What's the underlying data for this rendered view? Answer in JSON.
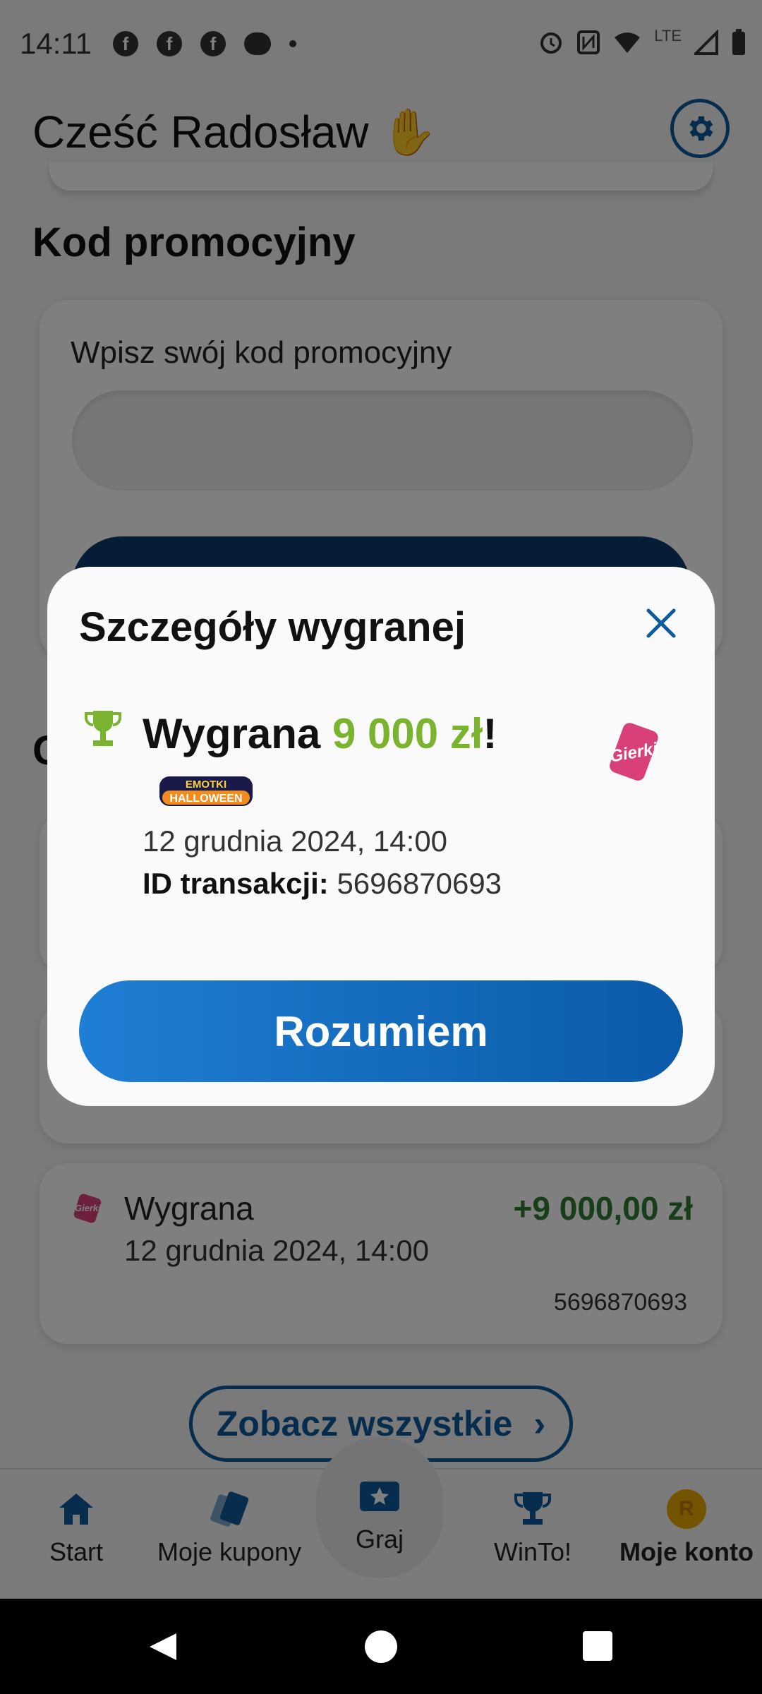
{
  "status_bar": {
    "time": "14:11",
    "network": "LTE"
  },
  "header": {
    "greeting": "Cześć Radosław",
    "greeting_emoji": "✋",
    "settings_icon": "gear-icon"
  },
  "promo": {
    "title": "Kod promocyjny",
    "label": "Wpisz swój kod promocyjny",
    "input_value": "",
    "section_partial": "C"
  },
  "transaction": {
    "title": "Wygrana",
    "date": "12 grudnia 2024, 14:00",
    "amount": "+9 000,00 zł",
    "id": "5696870693"
  },
  "see_all": {
    "label": "Zobacz wszystkie",
    "chevron": "›"
  },
  "bottom_nav": {
    "items": [
      {
        "label": "Start",
        "icon": "home-icon"
      },
      {
        "label": "Moje kupony",
        "icon": "coupon-icon"
      },
      {
        "label": "Graj",
        "icon": "ticket-star-icon"
      },
      {
        "label": "WinTo!",
        "icon": "trophy-icon"
      },
      {
        "label": "Moje konto",
        "icon": "avatar-icon",
        "avatar_letter": "R",
        "active": true
      }
    ]
  },
  "modal": {
    "title": "Szczegóły wygranej",
    "win_prefix": "Wygrana ",
    "win_amount": "9 000 zł",
    "win_suffix": "!",
    "game_logo_text_1": "EMOTKI",
    "game_logo_text_2": "HALLOWEEN",
    "provider_logo_text": "Gierki",
    "date": "12 grudnia 2024, 14:00",
    "id_label": "ID transakcji:",
    "id_value": "5696870693",
    "button_label": "Rozumiem"
  },
  "colors": {
    "primary": "#0d5a9c",
    "win_green": "#7ab32e",
    "amount_green": "#2e7d32",
    "scrim": "rgba(0,0,0,0.5)"
  }
}
